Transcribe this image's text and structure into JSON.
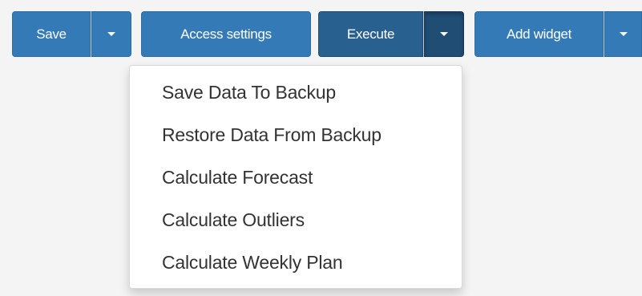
{
  "toolbar": {
    "save_label": "Save",
    "access_label": "Access settings",
    "execute_label": "Execute",
    "add_widget_label": "Add widget",
    "caret_icon": "caret-down-icon",
    "button_color": "#337ab7",
    "active_color": "#286090"
  },
  "execute_menu": {
    "items": [
      {
        "label": "Save Data To Backup"
      },
      {
        "label": "Restore Data From Backup"
      },
      {
        "label": "Calculate Forecast"
      },
      {
        "label": "Calculate Outliers"
      },
      {
        "label": "Calculate Weekly Plan"
      }
    ]
  }
}
